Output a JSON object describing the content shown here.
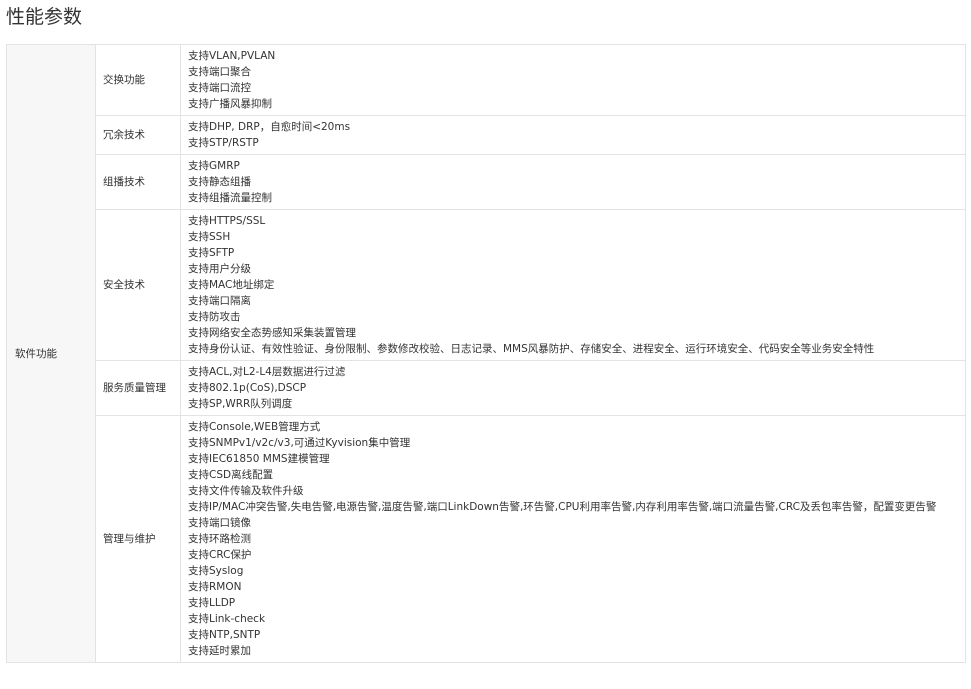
{
  "page_title": "性能参数",
  "category": "软件功能",
  "rows": [
    {
      "label": "交换功能",
      "values": [
        "支持VLAN,PVLAN",
        "支持端口聚合",
        "支持端口流控",
        "支持广播风暴抑制"
      ]
    },
    {
      "label": "冗余技术",
      "values": [
        "支持DHP, DRP，自愈时间<20ms",
        "支持STP/RSTP"
      ]
    },
    {
      "label": "组播技术",
      "values": [
        "支持GMRP",
        "支持静态组播",
        "支持组播流量控制"
      ]
    },
    {
      "label": "安全技术",
      "values": [
        "支持HTTPS/SSL",
        "支持SSH",
        "支持SFTP",
        "支持用户分级",
        "支持MAC地址绑定",
        "支持端口隔离",
        "支持防攻击",
        "支持网络安全态势感知采集装置管理",
        "支持身份认证、有效性验证、身份限制、参数修改校验、日志记录、MMS风暴防护、存储安全、进程安全、运行环境安全、代码安全等业务安全特性"
      ]
    },
    {
      "label": "服务质量管理",
      "values": [
        "支持ACL,对L2-L4层数据进行过滤",
        "支持802.1p(CoS),DSCP",
        "支持SP,WRR队列调度"
      ]
    },
    {
      "label": "管理与维护",
      "values": [
        "支持Console,WEB管理方式",
        "支持SNMPv1/v2c/v3,可通过Kyvision集中管理",
        "支持IEC61850 MMS建模管理",
        "支持CSD离线配置",
        "支持文件传输及软件升级",
        "支持IP/MAC冲突告警,失电告警,电源告警,温度告警,端口LinkDown告警,环告警,CPU利用率告警,内存利用率告警,端口流量告警,CRC及丢包率告警，配置变更告警",
        "支持端口镜像",
        "支持环路检测",
        "支持CRC保护",
        "支持Syslog",
        "支持RMON",
        "支持LLDP",
        "支持Link-check",
        "支持NTP,SNTP",
        "支持延时累加"
      ]
    }
  ]
}
